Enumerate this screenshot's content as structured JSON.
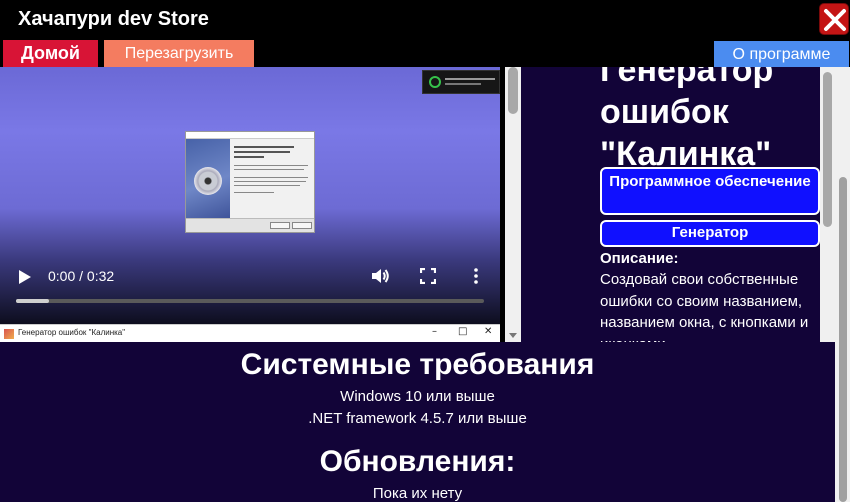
{
  "window": {
    "app_title": "Хачапури dev Store",
    "close_icon": "close-icon",
    "close_color": "#c41515"
  },
  "nav": {
    "home_label": "Домой",
    "reload_label": "Перезагрузить",
    "about_label": "О программе"
  },
  "video": {
    "time": "0:00 / 0:32",
    "progress": 0.07,
    "icons": [
      "play-icon",
      "volume-icon",
      "fullscreen-icon",
      "more-vert-icon"
    ]
  },
  "embedded_window": {
    "title": "Генератор ошибок \"Калинка\"",
    "min_icon": "–",
    "max_icon": "□",
    "close_icon": "✕"
  },
  "product": {
    "title": "Генератор ошибок \"Калинка\"",
    "tags": [
      "Программное обеспечение",
      "Генератор"
    ],
    "description_label": "Описание:",
    "description": "Создовай свои собственные ошибки со своим названием, названием окна, с кнопками и иконками"
  },
  "requirements": {
    "heading": "Системные требования",
    "items": [
      "Windows 10 или выше",
      ".NET framework 4.5.7 или выше"
    ]
  },
  "updates": {
    "heading": "Обновления:",
    "text": "Пока их нету"
  },
  "colors": {
    "background": "#120438",
    "tag_fill": "#1010ff",
    "home_button": "#d81436",
    "reload_button": "#f47c60",
    "about_button": "#4b8cf0"
  }
}
